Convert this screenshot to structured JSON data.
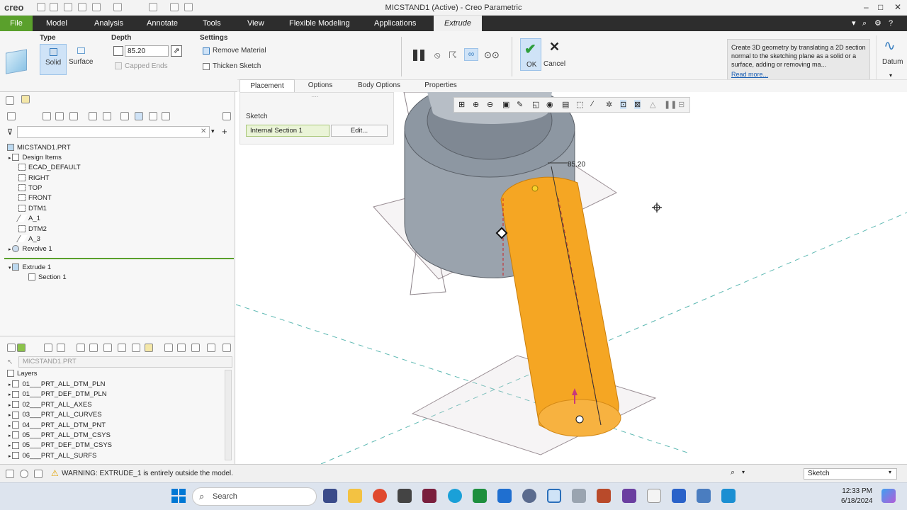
{
  "titlebar": {
    "app_name": "creo",
    "title": "MICSTAND1 (Active) - Creo Parametric",
    "minimize": "–",
    "maximize": "□",
    "close": "✕"
  },
  "menubar": {
    "items": [
      "File",
      "Model",
      "Analysis",
      "Annotate",
      "Tools",
      "View",
      "Flexible Modeling",
      "Applications",
      "Extrude"
    ],
    "right_icons": [
      "▾",
      "⌕",
      "⚙",
      "?"
    ]
  },
  "ribbon": {
    "type_label": "Type",
    "solid_label": "Solid",
    "surface_label": "Surface",
    "depth_label": "Depth",
    "depth_value": "85.20",
    "capped_ends_label": "Capped Ends",
    "settings_label": "Settings",
    "remove_material_label": "Remove Material",
    "thicken_sketch_label": "Thicken Sketch",
    "ok_label": "OK",
    "cancel_label": "Cancel",
    "help_text": "Create 3D geometry by translating a 2D section normal to the sketching plane as a solid or a surface, adding or removing ma...",
    "read_more": "Read more...",
    "datum_label": "Datum",
    "tabs": [
      "Placement",
      "Options",
      "Body Options",
      "Properties"
    ]
  },
  "sketch_panel": {
    "label": "Sketch",
    "section_value": "Internal Section 1",
    "edit_label": "Edit..."
  },
  "model_tree": {
    "root": "MICSTAND1.PRT",
    "items": [
      "Design Items",
      "ECAD_DEFAULT",
      "RIGHT",
      "TOP",
      "FRONT",
      "DTM1",
      "A_1",
      "DTM2",
      "A_3",
      "Revolve 1"
    ],
    "insert_items": [
      "Extrude 1",
      "Section 1"
    ]
  },
  "layers": {
    "model_select": "MICSTAND1.PRT",
    "header": "Layers",
    "items": [
      "01___PRT_ALL_DTM_PLN",
      "01___PRT_DEF_DTM_PLN",
      "02___PRT_ALL_AXES",
      "03___PRT_ALL_CURVES",
      "04___PRT_ALL_DTM_PNT",
      "05___PRT_ALL_DTM_CSYS",
      "05___PRT_DEF_DTM_CSYS",
      "06___PRT_ALL_SURFS"
    ]
  },
  "viewport": {
    "dimension_label": "85.20",
    "part_color": "#f5a623",
    "base_color": "#9aa3ad"
  },
  "statusbar": {
    "warning": "WARNING: EXTRUDE_1 is entirely outside the model.",
    "filter_value": "Sketch"
  },
  "taskbar": {
    "search_placeholder": "Search",
    "time": "12:33 PM",
    "date": "6/18/2024"
  }
}
